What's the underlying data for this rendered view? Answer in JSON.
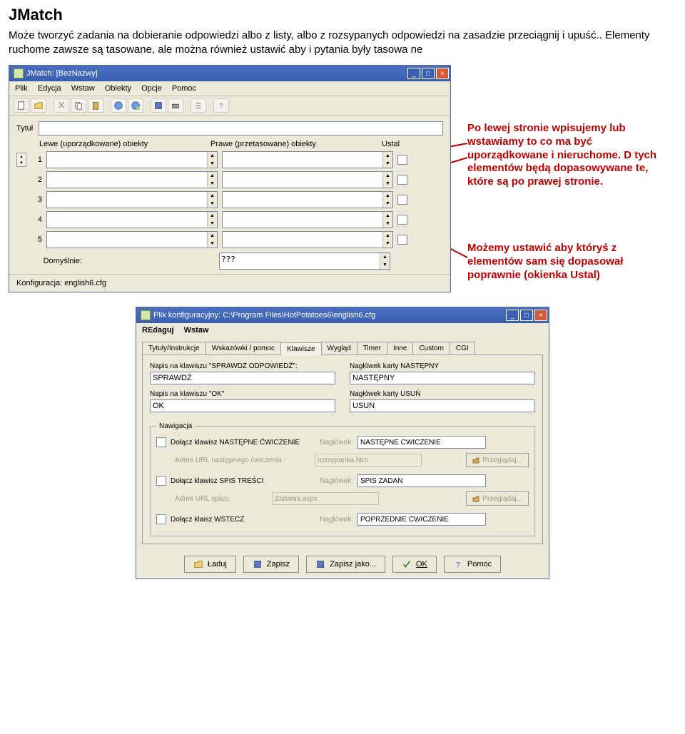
{
  "doc": {
    "title": "JMatch",
    "para": "Może tworzyć zadania na dobieranie odpowiedzi albo z listy, albo z rozsypanych odpowiedzi na zasadzie przeciągnij i upuść.. Elementy ruchome zawsze są tasowane, ale można również ustawić aby i pytania były tasowa  ne"
  },
  "jm": {
    "titlebar": "JMatch: [BezNazwy]",
    "menu": [
      "Plik",
      "Edycja",
      "Wstaw",
      "Obiekty",
      "Opcje",
      "Pomoc"
    ],
    "title_label": "Tytuł",
    "hdr_left": "Lewe (uporządkowane) obiekty",
    "hdr_right": "Prawe (przetasowane) obiekty",
    "hdr_fix": "Ustal",
    "rows": [
      "1",
      "2",
      "3",
      "4",
      "5"
    ],
    "default_label": "Domyślnie:",
    "default_right": "???",
    "cfg_label": "Konfiguracja: english6.cfg"
  },
  "ann": {
    "a1": "Po lewej stronie wpisujemy lub wstawiamy to co ma być uporządkowane i nieruchome. D tych elementów będą dopasowywane te, które są po prawej stronie.",
    "a2": "Możemy ustawić aby któryś z elementów sam się dopasował poprawnie (okienka Ustal)"
  },
  "cfg": {
    "titlebar": "Plik konfiguracyjny: C:\\Program Files\\HotPotatoes6\\english6.cfg",
    "menu": [
      "REdaguj",
      "Wstaw"
    ],
    "tabs": [
      "Tytuły/Instrukcje",
      "Wskazówki / pomoc",
      "Klawisze",
      "Wygląd",
      "Timer",
      "Inne",
      "Custom",
      "CGI"
    ],
    "active_tab": 2,
    "lbl_check": "Napis na klawiszu \"SPRAWDŹ ODPOWIEDŹ\":",
    "val_check": "SPRAWDŹ",
    "lbl_next": "Nagłówek karty NASTĘPNY",
    "val_next": "NASTĘPNY",
    "lbl_ok": "Napis na klawiszu \"OK\"",
    "val_ok": "OK",
    "lbl_del": "Nagłówek karty USUŃ",
    "val_del": "USUŃ",
    "nav_legend": "Nawigacja",
    "nav_next_chk": "Dołącz klawisz NASTĘPNE ĆWICZENIE",
    "nav_next_hdr_lbl": "Nagłówek:",
    "nav_next_hdr": "NASTĘPNE ĆWICZENIE",
    "nav_next_url_lbl": "Adres URL następnego ćwiczenia",
    "nav_next_url": "rozsypanka.htm",
    "nav_toc_chk": "Dołącz klawisz SPIS TREŚCI",
    "nav_toc_hdr": "SPIS ZADAŃ",
    "nav_toc_url_lbl": "Adres URL spisu:",
    "nav_toc_url": "Zadania.aspx",
    "nav_back_chk": "Dołącz klaisz WSTECZ",
    "nav_back_hdr": "POPRZEDNIE ĆWICZENIE",
    "browse": "Przeglądaj...",
    "btn_load": "Ładuj",
    "btn_save": "Zapisz",
    "btn_saveas": "Zapisz jako...",
    "btn_ok": "OK",
    "btn_help": "Pomoc"
  }
}
